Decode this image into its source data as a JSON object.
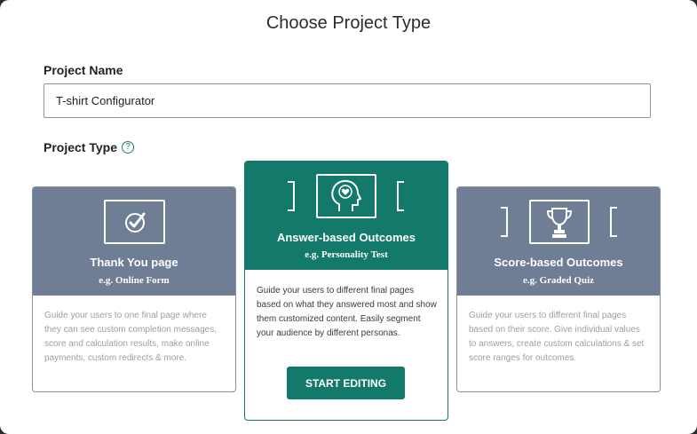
{
  "modal": {
    "title": "Choose Project Type"
  },
  "project_name": {
    "label": "Project Name",
    "value": "T-shirt Configurator"
  },
  "project_type": {
    "label": "Project Type",
    "help_icon": "?"
  },
  "cards": [
    {
      "title": "Thank You page",
      "subtitle": "e.g. Online Form",
      "icon": "checkmark-icon",
      "description": "Guide your users to one final page where they can see custom completion messages, score and calculation results, make online payments, custom redirects & more."
    },
    {
      "title": "Answer-based Outcomes",
      "subtitle": "e.g. Personality Test",
      "icon": "head-heart-icon",
      "description": "Guide your users to different final pages based on what they answered most and show them customized content. Easily segment your audience by different personas.",
      "button_label": "START EDITING"
    },
    {
      "title": "Score-based Outcomes",
      "subtitle": "e.g. Graded Quiz",
      "icon": "trophy-icon",
      "description": "Guide your users to different final pages based on their score. Give individual values to answers, create custom calculations & set score ranges for outcomes."
    }
  ],
  "colors": {
    "accent": "#137a6b",
    "card_header": "#6f7d95",
    "muted_text": "#9aa0a6"
  }
}
